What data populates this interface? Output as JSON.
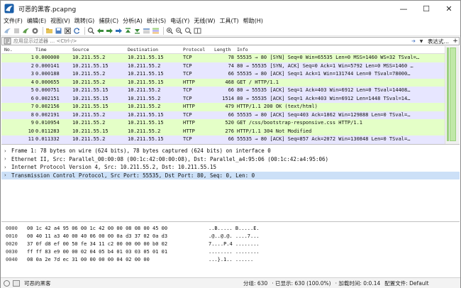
{
  "window": {
    "title": "可恶的黑客.pcapng",
    "controls": {
      "minimize": "—",
      "maximize": "☐",
      "close": "✕"
    }
  },
  "menu": [
    "文件(F)",
    "编辑(E)",
    "视图(V)",
    "跳转(G)",
    "捕获(C)",
    "分析(A)",
    "统计(S)",
    "电话(Y)",
    "无线(W)",
    "工具(T)",
    "帮助(H)"
  ],
  "filter": {
    "placeholder": "应用显示过滤器 … <Ctrl-/>",
    "expression_label": "表达式…",
    "add_label": "+"
  },
  "packet_list": {
    "columns": {
      "no": "No.",
      "time": "Time",
      "source": "Source",
      "destination": "Destination",
      "protocol": "Protocol",
      "length": "Length",
      "info": "Info"
    },
    "rows": [
      {
        "no": "1",
        "time": "0.000000",
        "src": "10.211.55.2",
        "dst": "10.211.55.15",
        "proto": "TCP",
        "len": "78",
        "info": "55535 → 80 [SYN] Seq=0 Win=65535 Len=0 MSS=1460 WS=32 TSval=…",
        "color": "tcp",
        "selected": true
      },
      {
        "no": "2",
        "time": "0.000141",
        "src": "10.211.55.15",
        "dst": "10.211.55.2",
        "proto": "TCP",
        "len": "74",
        "info": "80 → 55535 [SYN, ACK] Seq=0 Ack=1 Win=5792 Len=0 MSS=1460 …",
        "color": "tcp"
      },
      {
        "no": "3",
        "time": "0.000188",
        "src": "10.211.55.2",
        "dst": "10.211.55.15",
        "proto": "TCP",
        "len": "66",
        "info": "55535 → 80 [ACK] Seq=1 Ack=1 Win=131744 Len=0 TSval=78000…",
        "color": "tcp"
      },
      {
        "no": "4",
        "time": "0.000655",
        "src": "10.211.55.2",
        "dst": "10.211.55.15",
        "proto": "HTTP",
        "len": "468",
        "info": "GET / HTTP/1.1",
        "color": "http"
      },
      {
        "no": "5",
        "time": "0.000751",
        "src": "10.211.55.15",
        "dst": "10.211.55.2",
        "proto": "TCP",
        "len": "66",
        "info": "80 → 55535 [ACK] Seq=1 Ack=403 Win=6912 Len=0 TSval=14408…",
        "color": "tcp"
      },
      {
        "no": "6",
        "time": "0.002151",
        "src": "10.211.55.15",
        "dst": "10.211.55.2",
        "proto": "TCP",
        "len": "1514",
        "info": "80 → 55535 [ACK] Seq=1 Ack=403 Win=6912 Len=1448 TSval=14…",
        "color": "tcp"
      },
      {
        "no": "7",
        "time": "0.002156",
        "src": "10.211.55.15",
        "dst": "10.211.55.2",
        "proto": "HTTP",
        "len": "479",
        "info": "HTTP/1.1 200 OK  (text/html)",
        "color": "http"
      },
      {
        "no": "8",
        "time": "0.002191",
        "src": "10.211.55.2",
        "dst": "10.211.55.15",
        "proto": "TCP",
        "len": "66",
        "info": "55535 → 80 [ACK] Seq=403 Ack=1862 Win=129888 Len=0 TSval=…",
        "color": "tcp"
      },
      {
        "no": "9",
        "time": "0.010954",
        "src": "10.211.55.2",
        "dst": "10.211.55.15",
        "proto": "HTTP",
        "len": "520",
        "info": "GET /css/bootstrap-responsive.css HTTP/1.1",
        "color": "http"
      },
      {
        "no": "10",
        "time": "0.011283",
        "src": "10.211.55.15",
        "dst": "10.211.55.2",
        "proto": "HTTP",
        "len": "276",
        "info": "HTTP/1.1 304 Not Modified",
        "color": "http"
      },
      {
        "no": "11",
        "time": "0.011332",
        "src": "10.211.55.2",
        "dst": "10.211.55.15",
        "proto": "TCP",
        "len": "66",
        "info": "55535 → 80 [ACK] Seq=857 Ack=2072 Win=130848 Len=0 TSval=…",
        "color": "tcp"
      }
    ]
  },
  "details": [
    {
      "text": "Frame 1: 78 bytes on wire (624 bits), 78 bytes captured (624 bits) on interface 0",
      "selected": false
    },
    {
      "text": "Ethernet II, Src: Parallel_00:00:08 (00:1c:42:00:00:08), Dst: Parallel_a4:95:06 (00:1c:42:a4:95:06)",
      "selected": false
    },
    {
      "text": "Internet Protocol Version 4, Src: 10.211.55.2, Dst: 10.211.55.15",
      "selected": false
    },
    {
      "text": "Transmission Control Protocol, Src Port: 55535, Dst Port: 80, Seq: 0, Len: 0",
      "selected": true
    }
  ],
  "hex": [
    {
      "offset": "0000",
      "bytes": "00 1c 42 a4 95 06 00 1c  42 00 00 08 08 00 45 00",
      "ascii": "..B..... B.....E."
    },
    {
      "offset": "0010",
      "bytes": "00 40 11 a3 40 00 40 06  00 00 0a d3 37 02 0a d3",
      "ascii": ".@..@.@. ....7..."
    },
    {
      "offset": "0020",
      "bytes": "37 0f d8 ef 00 50 fe 34  11 c2 00 00 00 00 b0 02",
      "ascii": "7....P.4 ........"
    },
    {
      "offset": "0030",
      "bytes": "ff ff 83 e9 00 00 02 04  05 b4 01 03 03 05 01 01",
      "ascii": "........ ........"
    },
    {
      "offset": "0040",
      "bytes": "08 0a 2e 7d ec 31 00 00  00 00 04 02 00 00",
      "ascii": "...}.1.. ......"
    }
  ],
  "status": {
    "file_name": "可恶的黑客",
    "groups": "分组: 630",
    "displayed": "· 已显示: 630 (100.0%)",
    "load_time": "· 加载时间: 0:0.14",
    "profile": "配置文件: Default"
  },
  "colors": {
    "tcp_row": "#e7e6ff",
    "http_row": "#e4ffc7",
    "selected_detail": "#cce0f7"
  }
}
